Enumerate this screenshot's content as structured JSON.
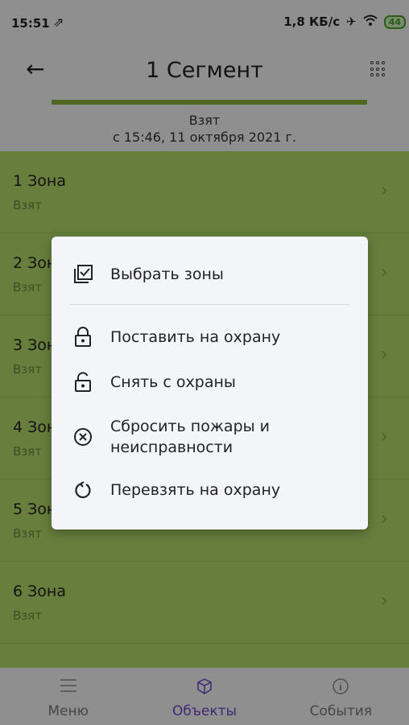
{
  "status_bar": {
    "time": "15:51",
    "speed": "1,8 КБ/с",
    "battery": "44"
  },
  "header": {
    "title": "1 Сегмент"
  },
  "segment_state": {
    "title": "Взят",
    "subtitle": "с 15:46, 11 октября 2021 г.",
    "progress": 1.0
  },
  "zones": [
    {
      "name": "1 Зона",
      "status": "Взят"
    },
    {
      "name": "2 Зона",
      "status": "Взят"
    },
    {
      "name": "3 Зона",
      "status": "Взят"
    },
    {
      "name": "4 Зона",
      "status": "Взят"
    },
    {
      "name": "5 Зона",
      "status": "Взят"
    },
    {
      "name": "6 Зона",
      "status": "Взят"
    }
  ],
  "menu": {
    "items": [
      {
        "label": "Выбрать зоны",
        "icon": "select-zones-icon"
      },
      {
        "label": "Поставить на охрану",
        "icon": "lock-icon"
      },
      {
        "label": "Снять с охраны",
        "icon": "unlock-icon"
      },
      {
        "label": "Сбросить пожары и\nнеисправности",
        "icon": "reset-icon"
      },
      {
        "label": "Перевзять на охрану",
        "icon": "rearm-icon"
      }
    ]
  },
  "nav": {
    "items": [
      {
        "label": "Меню",
        "icon": "menu-icon"
      },
      {
        "label": "Объекты",
        "icon": "box-icon"
      },
      {
        "label": "События",
        "icon": "info-icon"
      }
    ],
    "active_index": 1
  },
  "colors": {
    "zone_bg": "#b3da6a",
    "accent": "#6b44c8",
    "progress": "#8bb43d"
  }
}
